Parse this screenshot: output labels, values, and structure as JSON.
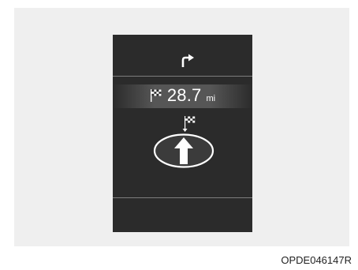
{
  "cluster": {
    "turn_icon": "turn-right-arrow-icon",
    "distance": {
      "flag_icon": "checkered-flag-icon",
      "value": "28.7",
      "unit": "mi"
    },
    "destination_icon": "destination-flag-icon",
    "direction_icon": "straight-arrow-icon"
  },
  "caption": "OPDE046147R",
  "colors": {
    "background": "#efefef",
    "display": "#2b2b2b",
    "text": "#ffffff",
    "divider": "#7d7d7d"
  }
}
